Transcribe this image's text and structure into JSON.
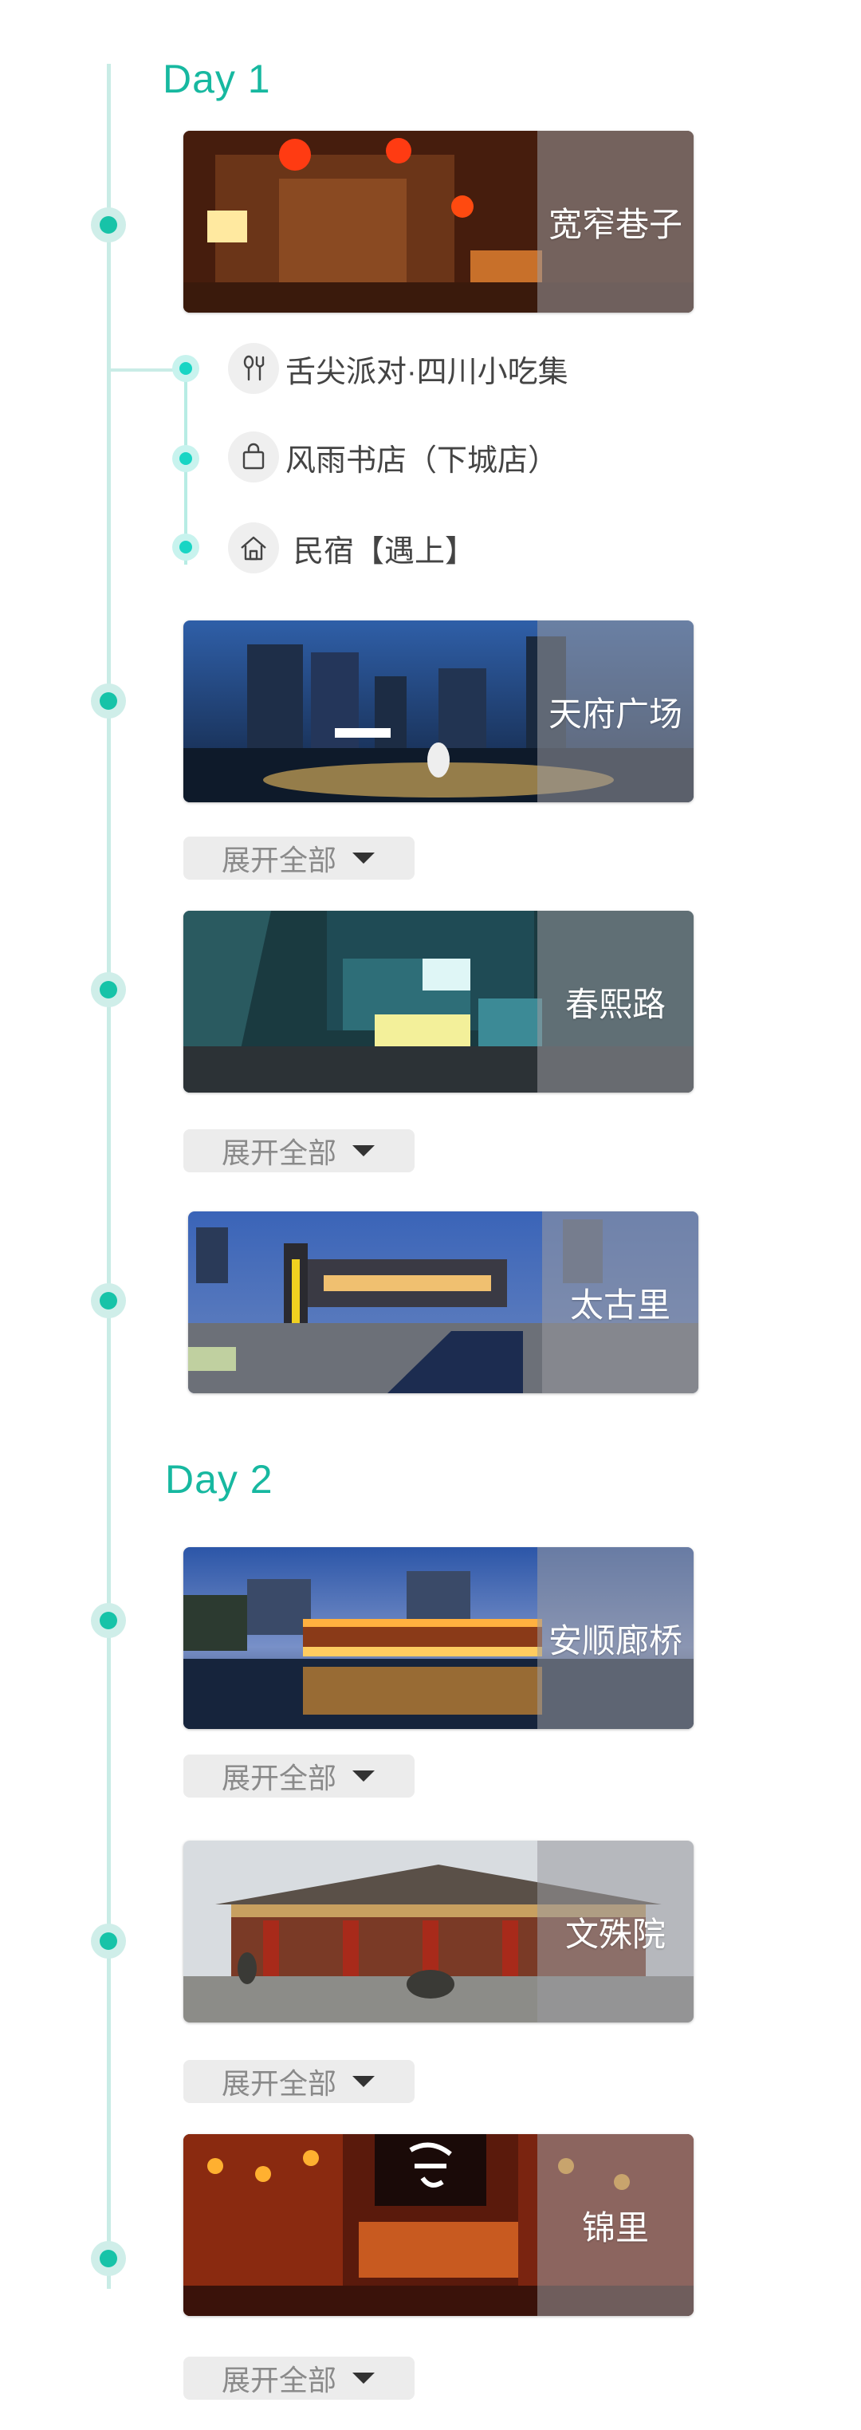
{
  "days": [
    "Day 1",
    "Day 2"
  ],
  "expand_label": "展开全部",
  "accent": "#17b8a0",
  "cards": [
    {
      "title": "宽窄巷子",
      "scene": "lantern-alley"
    },
    {
      "title": "天府广场",
      "scene": "night-city"
    },
    {
      "title": "春熙路",
      "scene": "ifs-plaza"
    },
    {
      "title": "太古里",
      "scene": "dusk-street"
    },
    {
      "title": "安顺廊桥",
      "scene": "lit-bridge"
    },
    {
      "title": "文殊院",
      "scene": "temple"
    },
    {
      "title": "锦里",
      "scene": "red-lantern-street"
    }
  ],
  "sub_items": [
    {
      "label": "舌尖派对·四川小吃集",
      "icon": "fork-spoon-icon"
    },
    {
      "label": "风雨书店（下城店）",
      "icon": "shopping-bag-icon"
    },
    {
      "label": "民宿【遇上】",
      "icon": "home-icon"
    }
  ]
}
